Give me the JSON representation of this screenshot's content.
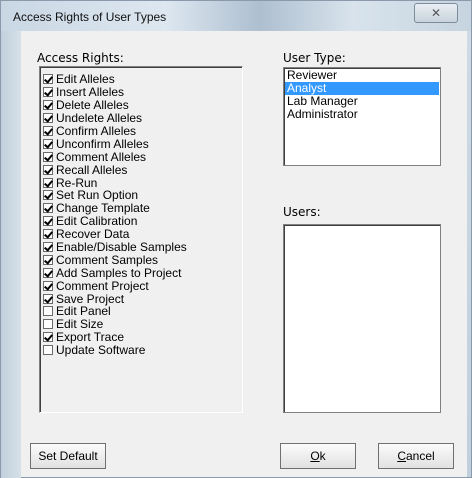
{
  "window": {
    "title": "Access Rights of User Types"
  },
  "access_rights": {
    "label": "Access Rights:",
    "items": [
      {
        "label": "Edit Alleles",
        "checked": true
      },
      {
        "label": "Insert Alleles",
        "checked": true
      },
      {
        "label": "Delete Alleles",
        "checked": true
      },
      {
        "label": "Undelete Alleles",
        "checked": true
      },
      {
        "label": "Confirm Alleles",
        "checked": true
      },
      {
        "label": "Unconfirm Alleles",
        "checked": true
      },
      {
        "label": "Comment Alleles",
        "checked": true
      },
      {
        "label": "Recall Alleles",
        "checked": true
      },
      {
        "label": "Re-Run",
        "checked": true
      },
      {
        "label": "Set Run Option",
        "checked": true
      },
      {
        "label": "Change Template",
        "checked": true
      },
      {
        "label": "Edit Calibration",
        "checked": true
      },
      {
        "label": "Recover Data",
        "checked": true
      },
      {
        "label": "Enable/Disable Samples",
        "checked": true
      },
      {
        "label": "Comment Samples",
        "checked": true
      },
      {
        "label": "Add Samples to Project",
        "checked": true
      },
      {
        "label": "Comment Project",
        "checked": true
      },
      {
        "label": "Save Project",
        "checked": true
      },
      {
        "label": "Edit Panel",
        "checked": false
      },
      {
        "label": "Edit Size",
        "checked": false
      },
      {
        "label": "Export Trace",
        "checked": true
      },
      {
        "label": "Update Software",
        "checked": false
      }
    ]
  },
  "user_type": {
    "label": "User Type:",
    "items": [
      "Reviewer",
      "Analyst",
      "Lab Manager",
      "Administrator"
    ],
    "selected": "Analyst"
  },
  "users": {
    "label": "Users:",
    "items": []
  },
  "buttons": {
    "set_default": "Set Default",
    "ok_mnemonic": "O",
    "ok_rest": "k",
    "cancel_mnemonic": "C",
    "cancel_rest": "ancel"
  },
  "icons": {
    "close": "close-icon"
  },
  "colors": {
    "selection": "#3399ff",
    "dialog_bg": "#f0f0f0"
  }
}
